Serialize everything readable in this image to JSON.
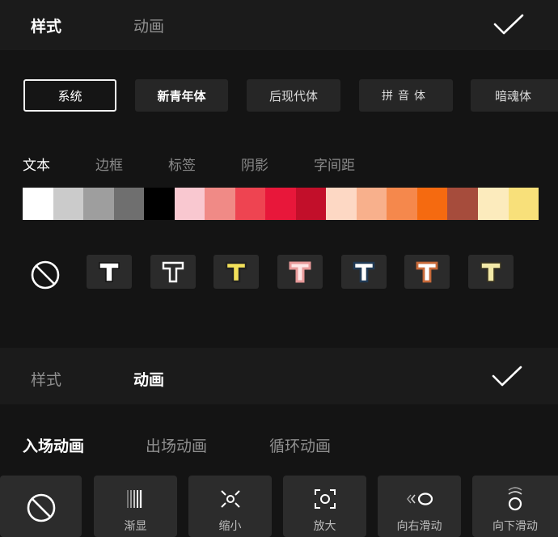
{
  "top_panel": {
    "tabs": [
      {
        "label": "样式"
      },
      {
        "label": "动画"
      }
    ],
    "fonts": [
      {
        "label": "系统"
      },
      {
        "label": "新青年体"
      },
      {
        "label": "后现代体"
      },
      {
        "label": "拼音体"
      },
      {
        "label": "暗魂体"
      }
    ],
    "subtabs": [
      {
        "label": "文本"
      },
      {
        "label": "边框"
      },
      {
        "label": "标签"
      },
      {
        "label": "阴影"
      },
      {
        "label": "字间距"
      }
    ],
    "colors": [
      "#ffffff",
      "#cbcbcb",
      "#9e9e9e",
      "#6f6f6f",
      "#000000",
      "#f9c8d0",
      "#f08a86",
      "#ee4451",
      "#e8173a",
      "#c20f2a",
      "#fdd8c4",
      "#f8b08c",
      "#f5884c",
      "#f56a10",
      "#a64c3c",
      "#fcebbd",
      "#f8e07a"
    ],
    "text_styles": [
      {
        "icon": "t-solid-white"
      },
      {
        "icon": "t-outline-white"
      },
      {
        "icon": "t-yellow-outline"
      },
      {
        "icon": "t-pink-glow"
      },
      {
        "icon": "t-white-blue-outline"
      },
      {
        "icon": "t-orange-outline"
      },
      {
        "icon": "t-yellow-solid"
      }
    ]
  },
  "bottom_panel": {
    "tabs": [
      {
        "label": "样式"
      },
      {
        "label": "动画"
      }
    ],
    "anim_subtabs": [
      {
        "label": "入场动画"
      },
      {
        "label": "出场动画"
      },
      {
        "label": "循环动画"
      }
    ],
    "animations": [
      {
        "label": "",
        "icon": "none-icon"
      },
      {
        "label": "渐显",
        "icon": "fade-in-icon"
      },
      {
        "label": "缩小",
        "icon": "zoom-out-icon"
      },
      {
        "label": "放大",
        "icon": "zoom-in-icon"
      },
      {
        "label": "向右滑动",
        "icon": "slide-right-icon"
      },
      {
        "label": "向下滑动",
        "icon": "slide-down-icon"
      }
    ]
  }
}
